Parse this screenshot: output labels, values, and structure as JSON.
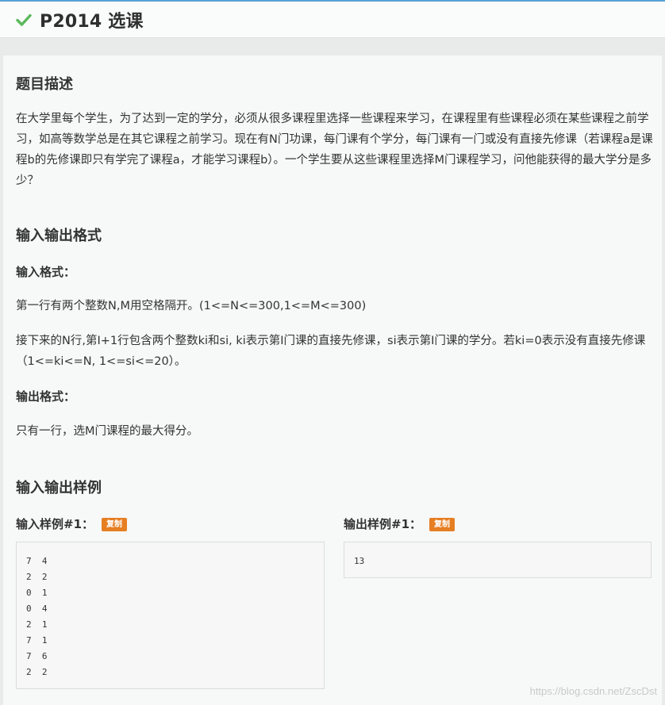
{
  "header": {
    "title": "P2014 选课",
    "check_color": "#5cb85c"
  },
  "description": {
    "heading": "题目描述",
    "text": "在大学里每个学生，为了达到一定的学分，必须从很多课程里选择一些课程来学习，在课程里有些课程必须在某些课程之前学习，如高等数学总是在其它课程之前学习。现在有N门功课，每门课有个学分，每门课有一门或没有直接先修课（若课程a是课程b的先修课即只有学完了课程a，才能学习课程b）。一个学生要从这些课程里选择M门课程学习，问他能获得的最大学分是多少？"
  },
  "io_format": {
    "heading": "输入输出格式",
    "input_label": "输入格式：",
    "input_line1": "第一行有两个整数N,M用空格隔开。(1<=N<=300,1<=M<=300)",
    "input_line2": "接下来的N行,第I+1行包含两个整数ki和si, ki表示第I门课的直接先修课，si表示第I门课的学分。若ki=0表示没有直接先修课（1<=ki<=N, 1<=si<=20）。",
    "output_label": "输出格式：",
    "output_line": "只有一行，选M门课程的最大得分。"
  },
  "samples": {
    "heading": "输入输出样例",
    "input_label": "输入样例#1：",
    "output_label": "输出样例#1：",
    "copy_label": "复制",
    "input_lines": [
      "7  4",
      "2  2",
      "0  1",
      "0  4",
      "2  1",
      "7  1",
      "7  6",
      "2  2"
    ],
    "output_lines": [
      "13"
    ]
  },
  "watermark": "https://blog.csdn.net/ZscDst"
}
